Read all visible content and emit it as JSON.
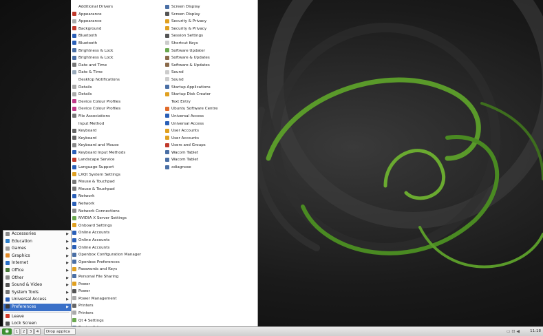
{
  "main_menu": {
    "items": [
      {
        "label": "Accessories",
        "icon": "accessories-icon",
        "color": "#8a8a8a",
        "submenu": true
      },
      {
        "label": "Education",
        "icon": "education-icon",
        "color": "#2e7fc9",
        "submenu": true
      },
      {
        "label": "Games",
        "icon": "games-icon",
        "color": "#9a9a9a",
        "submenu": true
      },
      {
        "label": "Graphics",
        "icon": "graphics-icon",
        "color": "#e08a2a",
        "submenu": true
      },
      {
        "label": "Internet",
        "icon": "internet-icon",
        "color": "#2a6fc7",
        "submenu": true
      },
      {
        "label": "Office",
        "icon": "office-icon",
        "color": "#4a7a3a",
        "submenu": true
      },
      {
        "label": "Other",
        "icon": "other-icon",
        "color": "#8a8a8a",
        "submenu": true
      },
      {
        "label": "Sound & Video",
        "icon": "sound-video-icon",
        "color": "#555555",
        "submenu": true
      },
      {
        "label": "System Tools",
        "icon": "system-tools-icon",
        "color": "#777777",
        "submenu": true
      },
      {
        "label": "Universal Access",
        "icon": "universal-access-icon",
        "color": "#2a5fb7",
        "submenu": true
      },
      {
        "label": "Preferences",
        "icon": "preferences-icon",
        "color": "#3a3a3a",
        "submenu": true,
        "active": true
      },
      {
        "label": "Leave",
        "icon": "leave-icon",
        "color": "#d23a2a",
        "submenu": false
      },
      {
        "label": "Lock Screen",
        "icon": "lock-screen-icon",
        "color": "#555555",
        "submenu": false
      }
    ]
  },
  "preferences": {
    "column1": [
      {
        "label": "Additional Drivers",
        "icon": "additional-drivers-icon",
        "color": "#ffffff"
      },
      {
        "label": "Appearance",
        "icon": "appearance-icon",
        "color": "#c0392b"
      },
      {
        "label": "Appearance",
        "icon": "appearance-icon",
        "color": "#aaaaaa"
      },
      {
        "label": "Background",
        "icon": "background-icon",
        "color": "#c0392b"
      },
      {
        "label": "Bluetooth",
        "icon": "bluetooth-icon",
        "color": "#2a5fb7"
      },
      {
        "label": "Bluetooth",
        "icon": "bluetooth-icon",
        "color": "#2a5fb7"
      },
      {
        "label": "Brightness & Lock",
        "icon": "brightness-icon",
        "color": "#4a6fa5"
      },
      {
        "label": "Brightness & Lock",
        "icon": "brightness-icon",
        "color": "#4a6fa5"
      },
      {
        "label": "Date and Time",
        "icon": "clock-icon",
        "color": "#777777"
      },
      {
        "label": "Date & Time",
        "icon": "clock-icon",
        "color": "#9ab"
      },
      {
        "label": "Desktop Notifications",
        "icon": "notifications-icon",
        "color": "#ffffff"
      },
      {
        "label": "Details",
        "icon": "details-icon",
        "color": "#aaaaaa"
      },
      {
        "label": "Details",
        "icon": "details-icon",
        "color": "#aaaaaa"
      },
      {
        "label": "Device Colour Profiles",
        "icon": "color-profile-icon",
        "color": "#c23a8a"
      },
      {
        "label": "Device Colour Profiles",
        "icon": "color-profile-icon",
        "color": "#c23a8a"
      },
      {
        "label": "File Associations",
        "icon": "file-associations-icon",
        "color": "#777777"
      },
      {
        "label": "Input Method",
        "icon": "input-method-icon",
        "color": "#ffffff"
      },
      {
        "label": "Keyboard",
        "icon": "keyboard-icon",
        "color": "#666666"
      },
      {
        "label": "Keyboard",
        "icon": "keyboard-icon",
        "color": "#666666"
      },
      {
        "label": "Keyboard and Mouse",
        "icon": "keyboard-mouse-icon",
        "color": "#888888"
      },
      {
        "label": "Keyboard Input Methods",
        "icon": "input-methods-icon",
        "color": "#2a5fb7"
      },
      {
        "label": "Landscape Service",
        "icon": "landscape-icon",
        "color": "#c0392b"
      },
      {
        "label": "Language Support",
        "icon": "language-icon",
        "color": "#2a5fb7"
      },
      {
        "label": "LXQt System Settings",
        "icon": "lxqt-settings-icon",
        "color": "#e0a020"
      },
      {
        "label": "Mouse & Touchpad",
        "icon": "mouse-icon",
        "color": "#777777"
      },
      {
        "label": "Mouse & Touchpad",
        "icon": "mouse-icon",
        "color": "#777777"
      },
      {
        "label": "Network",
        "icon": "network-icon",
        "color": "#2a5fb7"
      },
      {
        "label": "Network",
        "icon": "network-icon",
        "color": "#2a5fb7"
      },
      {
        "label": "Network Connections",
        "icon": "network-connections-icon",
        "color": "#888888"
      },
      {
        "label": "NVIDIA X Server Settings",
        "icon": "nvidia-icon",
        "color": "#6aa84f"
      },
      {
        "label": "Onboard Settings",
        "icon": "onboard-icon",
        "color": "#e0a020"
      },
      {
        "label": "Online Accounts",
        "icon": "online-accounts-icon",
        "color": "#2a5fb7"
      },
      {
        "label": "Online Accounts",
        "icon": "online-accounts-icon",
        "color": "#2a5fb7"
      },
      {
        "label": "Online Accounts",
        "icon": "online-accounts-icon",
        "color": "#2a5fb7"
      },
      {
        "label": "Openbox Configuration Manager",
        "icon": "openbox-icon",
        "color": "#4a6fa5"
      },
      {
        "label": "Openbox Preferences",
        "icon": "openbox-icon",
        "color": "#4a6fa5"
      },
      {
        "label": "Passwords and Keys",
        "icon": "keys-icon",
        "color": "#e0a020"
      },
      {
        "label": "Personal File Sharing",
        "icon": "file-sharing-icon",
        "color": "#4a6fa5"
      },
      {
        "label": "Power",
        "icon": "power-icon",
        "color": "#e0a020"
      },
      {
        "label": "Power",
        "icon": "power-icon",
        "color": "#555555"
      },
      {
        "label": "Power Management",
        "icon": "power-management-icon",
        "color": "#aaaaaa"
      },
      {
        "label": "Printers",
        "icon": "printer-icon",
        "color": "#666666"
      },
      {
        "label": "Printers",
        "icon": "printer-icon",
        "color": "#aaaaaa"
      },
      {
        "label": "Qt 4 Settings",
        "icon": "qt-icon",
        "color": "#6aa84f"
      },
      {
        "label": "Region & Language",
        "icon": "region-icon",
        "color": "#4a6fa5"
      }
    ],
    "column2": [
      {
        "label": "Screen Display",
        "icon": "display-icon",
        "color": "#4a6fa5"
      },
      {
        "label": "Screen Display",
        "icon": "display-icon",
        "color": "#555555"
      },
      {
        "label": "Security & Privacy",
        "icon": "security-icon",
        "color": "#e0a020"
      },
      {
        "label": "Security & Privacy",
        "icon": "security-icon",
        "color": "#e0a020"
      },
      {
        "label": "Session Settings",
        "icon": "session-icon",
        "color": "#555555"
      },
      {
        "label": "Shortcut Keys",
        "icon": "shortcut-keys-icon",
        "color": "#cccccc"
      },
      {
        "label": "Software Updater",
        "icon": "software-updater-icon",
        "color": "#6aa84f"
      },
      {
        "label": "Software & Updates",
        "icon": "software-updates-icon",
        "color": "#8a6a4a"
      },
      {
        "label": "Software & Updates",
        "icon": "software-updates-icon",
        "color": "#8a6a4a"
      },
      {
        "label": "Sound",
        "icon": "sound-icon",
        "color": "#cccccc"
      },
      {
        "label": "Sound",
        "icon": "sound-icon",
        "color": "#cccccc"
      },
      {
        "label": "Startup Applications",
        "icon": "startup-icon",
        "color": "#4a6fa5"
      },
      {
        "label": "Startup Disk Creator",
        "icon": "disk-creator-icon",
        "color": "#e0a020"
      },
      {
        "label": "Text Entry",
        "icon": "text-entry-icon",
        "color": "#ffffff"
      },
      {
        "label": "Ubuntu Software Centre",
        "icon": "software-centre-icon",
        "color": "#e06a2a"
      },
      {
        "label": "Universal Access",
        "icon": "universal-access-icon",
        "color": "#2a5fb7"
      },
      {
        "label": "Universal Access",
        "icon": "universal-access-icon",
        "color": "#2a5fb7"
      },
      {
        "label": "User Accounts",
        "icon": "user-accounts-icon",
        "color": "#e0a020"
      },
      {
        "label": "User Accounts",
        "icon": "user-accounts-icon",
        "color": "#e0a020"
      },
      {
        "label": "Users and Groups",
        "icon": "users-groups-icon",
        "color": "#c0392b"
      },
      {
        "label": "Wacom Tablet",
        "icon": "wacom-icon",
        "color": "#4a6fa5"
      },
      {
        "label": "Wacom Tablet",
        "icon": "wacom-icon",
        "color": "#4a6fa5"
      },
      {
        "label": "xdiagnose",
        "icon": "xdiagnose-icon",
        "color": "#4a6fa5"
      }
    ]
  },
  "taskbar": {
    "start_label": "",
    "workspaces": [
      "1",
      "2",
      "3",
      "4"
    ],
    "task_label": "Drop applica",
    "clock": "11:18"
  },
  "colors": {
    "accent": "#3a70c8",
    "wallpaper_swirl": "#5a9a2a"
  }
}
